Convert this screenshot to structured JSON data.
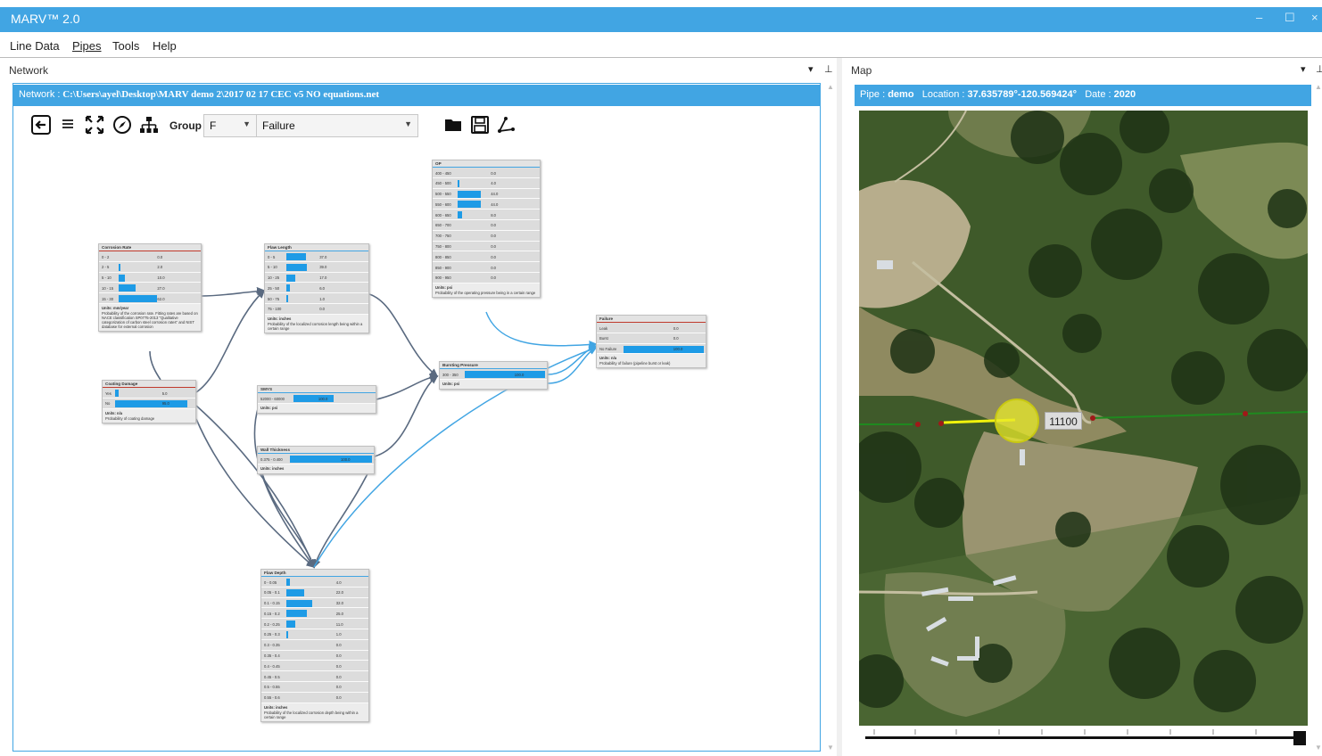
{
  "app": {
    "title": "MARV™ 2.0",
    "minimize": "–",
    "maximize": "☐",
    "close": "×"
  },
  "menu": [
    "Line Data",
    "Pipes",
    "Tools",
    "Help"
  ],
  "network_panel": {
    "label": "Network",
    "path_key": "Network :",
    "path_value": "C:\\Users\\ayel\\Desktop\\MARV demo 2\\2017 02 17 CEC v5 NO equations.net",
    "toolbar": {
      "group_label": "Group",
      "group_value": "F",
      "node_value": "Failure"
    }
  },
  "map_panel": {
    "label": "Map",
    "pipe_key": "Pipe :",
    "pipe_value": "demo",
    "location_key": "Location :",
    "location_value": "37.635789°-120.569424°",
    "date_key": "Date :",
    "date_value": "2020",
    "pipe_marker_label": "11100"
  },
  "nodes": [
    {
      "id": "corrosion",
      "title": "Corrosion Rate",
      "accent": "red",
      "rows": [
        [
          "0 - 2",
          "0.0",
          0
        ],
        [
          "2 - 5",
          "2.0",
          0.02
        ],
        [
          "5 - 10",
          "10.0",
          0.1
        ],
        [
          "10 - 15",
          "27.0",
          0.27
        ],
        [
          "15 - 30",
          "62.0",
          0.62
        ]
      ],
      "units": "Units: mm/year",
      "desc": "Probability of the corrosion rate. Fitting rates are based on NACE classification SP0775-2013 \"Qualitative categorization of carbon steel corrosion rates\" and NIST database for external corrosion"
    },
    {
      "id": "flawlength",
      "title": "Flaw Length",
      "accent": "blue",
      "rows": [
        [
          "0 - 5",
          "37.0",
          0.37
        ],
        [
          "5 - 10",
          "39.0",
          0.39
        ],
        [
          "10 - 25",
          "17.0",
          0.17
        ],
        [
          "25 - 50",
          "6.0",
          0.06
        ],
        [
          "50 - 75",
          "1.0",
          0.01
        ],
        [
          "75 - 100",
          "0.0",
          0
        ]
      ],
      "units": "Units: inches",
      "desc": "Probability of the localized corrosion length being within a certain range"
    },
    {
      "id": "op",
      "title": "OP",
      "accent": "blue",
      "rows": [
        [
          "400 - 450",
          "0.0",
          0
        ],
        [
          "450 - 500",
          "4.0",
          0.04
        ],
        [
          "500 - 550",
          "44.0",
          0.44
        ],
        [
          "550 - 600",
          "44.0",
          0.44
        ],
        [
          "600 - 650",
          "8.0",
          0.08
        ],
        [
          "650 - 700",
          "0.0",
          0
        ],
        [
          "700 - 750",
          "0.0",
          0
        ],
        [
          "750 - 800",
          "0.0",
          0
        ],
        [
          "800 - 850",
          "0.0",
          0
        ],
        [
          "850 - 900",
          "0.0",
          0
        ],
        [
          "900 - 950",
          "0.0",
          0
        ]
      ],
      "units": "Units: psi",
      "desc": "Probability of the operating pressure being in a certain range"
    },
    {
      "id": "failure",
      "title": "Failure",
      "accent": "red",
      "rows": [
        [
          "Leak",
          "0.0",
          0
        ],
        [
          "Burst",
          "0.0",
          0
        ],
        [
          "No Failure",
          "100.0",
          1
        ]
      ],
      "units": "Units: n/a",
      "desc": "Probability of failure (pipeline burst or leak)"
    },
    {
      "id": "bursting",
      "title": "Bursting Pressure",
      "accent": "blue",
      "rows": [
        [
          "300 - 350",
          "100.0",
          1
        ]
      ],
      "units": "Units: psi",
      "desc": ""
    },
    {
      "id": "coating",
      "title": "Coating Damage",
      "accent": "red",
      "rows": [
        [
          "Yes",
          "5.0",
          0.05
        ],
        [
          "No",
          "95.0",
          0.95
        ]
      ],
      "units": "Units: n/a",
      "desc": "Probability of coating damage"
    },
    {
      "id": "smys",
      "title": "SMYS",
      "accent": "blue",
      "rows": [
        [
          "52000 - 60000",
          "100.0",
          1
        ]
      ],
      "units": "Units: psi",
      "desc": ""
    },
    {
      "id": "wallthickness",
      "title": "Wall Thickness",
      "accent": "blue",
      "rows": [
        [
          "0.375 - 0.400",
          "100.0",
          1
        ]
      ],
      "units": "Units: inches",
      "desc": ""
    },
    {
      "id": "flawdepth",
      "title": "Flaw Depth",
      "accent": "blue",
      "rows": [
        [
          "0 - 0.05",
          "4.0",
          0.04
        ],
        [
          "0.05 - 0.1",
          "22.0",
          0.22
        ],
        [
          "0.1 - 0.15",
          "32.0",
          0.32
        ],
        [
          "0.15 - 0.2",
          "25.0",
          0.25
        ],
        [
          "0.2 - 0.25",
          "11.0",
          0.11
        ],
        [
          "0.25 - 0.3",
          "1.0",
          0.01
        ],
        [
          "0.3 - 0.35",
          "0.0",
          0
        ],
        [
          "0.35 - 0.4",
          "0.0",
          0
        ],
        [
          "0.4 - 0.45",
          "0.0",
          0
        ],
        [
          "0.45 - 0.5",
          "0.0",
          0
        ],
        [
          "0.5 - 0.55",
          "0.0",
          0
        ],
        [
          "0.55 - 0.6",
          "0.0",
          0
        ]
      ],
      "units": "Units: inches",
      "desc": "Probability of the localized corrosion depth being within a certain range"
    }
  ],
  "colors": {
    "accent": "#41a5e3",
    "bar": "#1e9be6",
    "pipe_green": "#1f8a1f",
    "pipe_selected": "#f2f20c"
  }
}
